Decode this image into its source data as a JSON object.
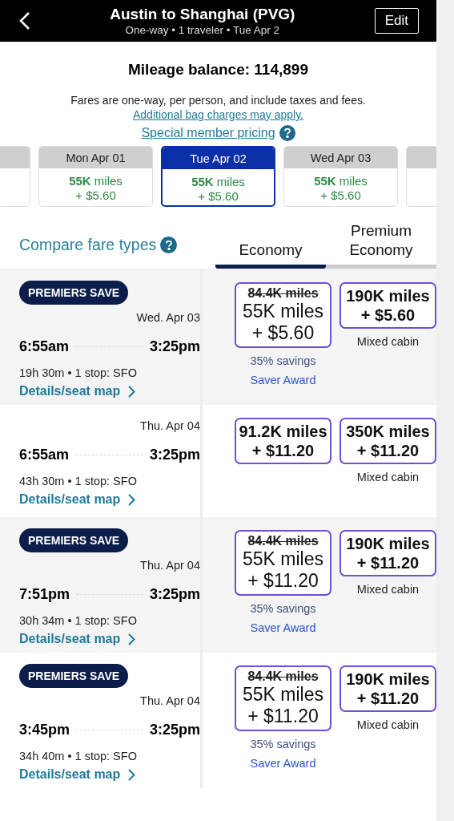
{
  "header": {
    "title": "Austin to Shanghai (PVG)",
    "subtitle": "One-way • 1 traveler • Tue Apr 2",
    "edit": "Edit"
  },
  "balance": "Mileage balance: 114,899",
  "notice": {
    "text": "Fares are one-way, per person, and include taxes and fees.",
    "link": "Additional bag charges may apply."
  },
  "member_pricing": "Special member pricing",
  "date_cards": [
    {
      "day": "Mon Apr 01",
      "miles": "55K",
      "unit": "miles",
      "fee": "+ $5.60",
      "selected": false
    },
    {
      "day": "Tue Apr 02",
      "miles": "55K",
      "unit": "miles",
      "fee": "+ $5.60",
      "selected": true
    },
    {
      "day": "Wed Apr 03",
      "miles": "55K",
      "unit": "miles",
      "fee": "+ $5.60",
      "selected": false
    }
  ],
  "compare": "Compare fare types",
  "fare_tabs": [
    {
      "label": "Economy",
      "selected": true
    },
    {
      "label": "Premium Economy",
      "selected": false
    }
  ],
  "flights": [
    {
      "badge": "PREMIERS SAVE",
      "date": "Wed. Apr 03",
      "depart": "6:55am",
      "arrive": "3:25pm",
      "summary": "19h 30m • 1 stop: SFO",
      "details": "Details/seat map",
      "fares": [
        {
          "original": "84.4K miles",
          "miles": "55K miles",
          "fee": "+ $5.60",
          "savings": "35% savings",
          "award": "Saver Award"
        },
        {
          "miles": "190K miles",
          "fee": "+ $5.60",
          "note": "Mixed cabin"
        }
      ]
    },
    {
      "date": "Thu. Apr 04",
      "depart": "6:55am",
      "arrive": "3:25pm",
      "summary": "43h 30m • 1 stop: SFO",
      "details": "Details/seat map",
      "fares": [
        {
          "miles": "91.2K miles",
          "fee": "+ $11.20"
        },
        {
          "miles": "350K miles",
          "fee": "+ $11.20",
          "note": "Mixed cabin"
        }
      ]
    },
    {
      "badge": "PREMIERS SAVE",
      "date": "Thu. Apr 04",
      "depart": "7:51pm",
      "arrive": "3:25pm",
      "summary": "30h 34m • 1 stop: SFO",
      "details": "Details/seat map",
      "fares": [
        {
          "original": "84.4K miles",
          "miles": "55K miles",
          "fee": "+ $11.20",
          "savings": "35% savings",
          "award": "Saver Award"
        },
        {
          "miles": "190K miles",
          "fee": "+ $11.20",
          "note": "Mixed cabin"
        }
      ]
    },
    {
      "badge": "PREMIERS SAVE",
      "date": "Thu. Apr 04",
      "depart": "3:45pm",
      "arrive": "3:25pm",
      "summary": "34h 40m • 1 stop: SFO",
      "details": "Details/seat map",
      "fares": [
        {
          "original": "84.4K miles",
          "miles": "55K miles",
          "fee": "+ $11.20",
          "savings": "35% savings",
          "award": "Saver Award"
        },
        {
          "miles": "190K miles",
          "fee": "+ $11.20",
          "note": "Mixed cabin"
        }
      ]
    }
  ]
}
